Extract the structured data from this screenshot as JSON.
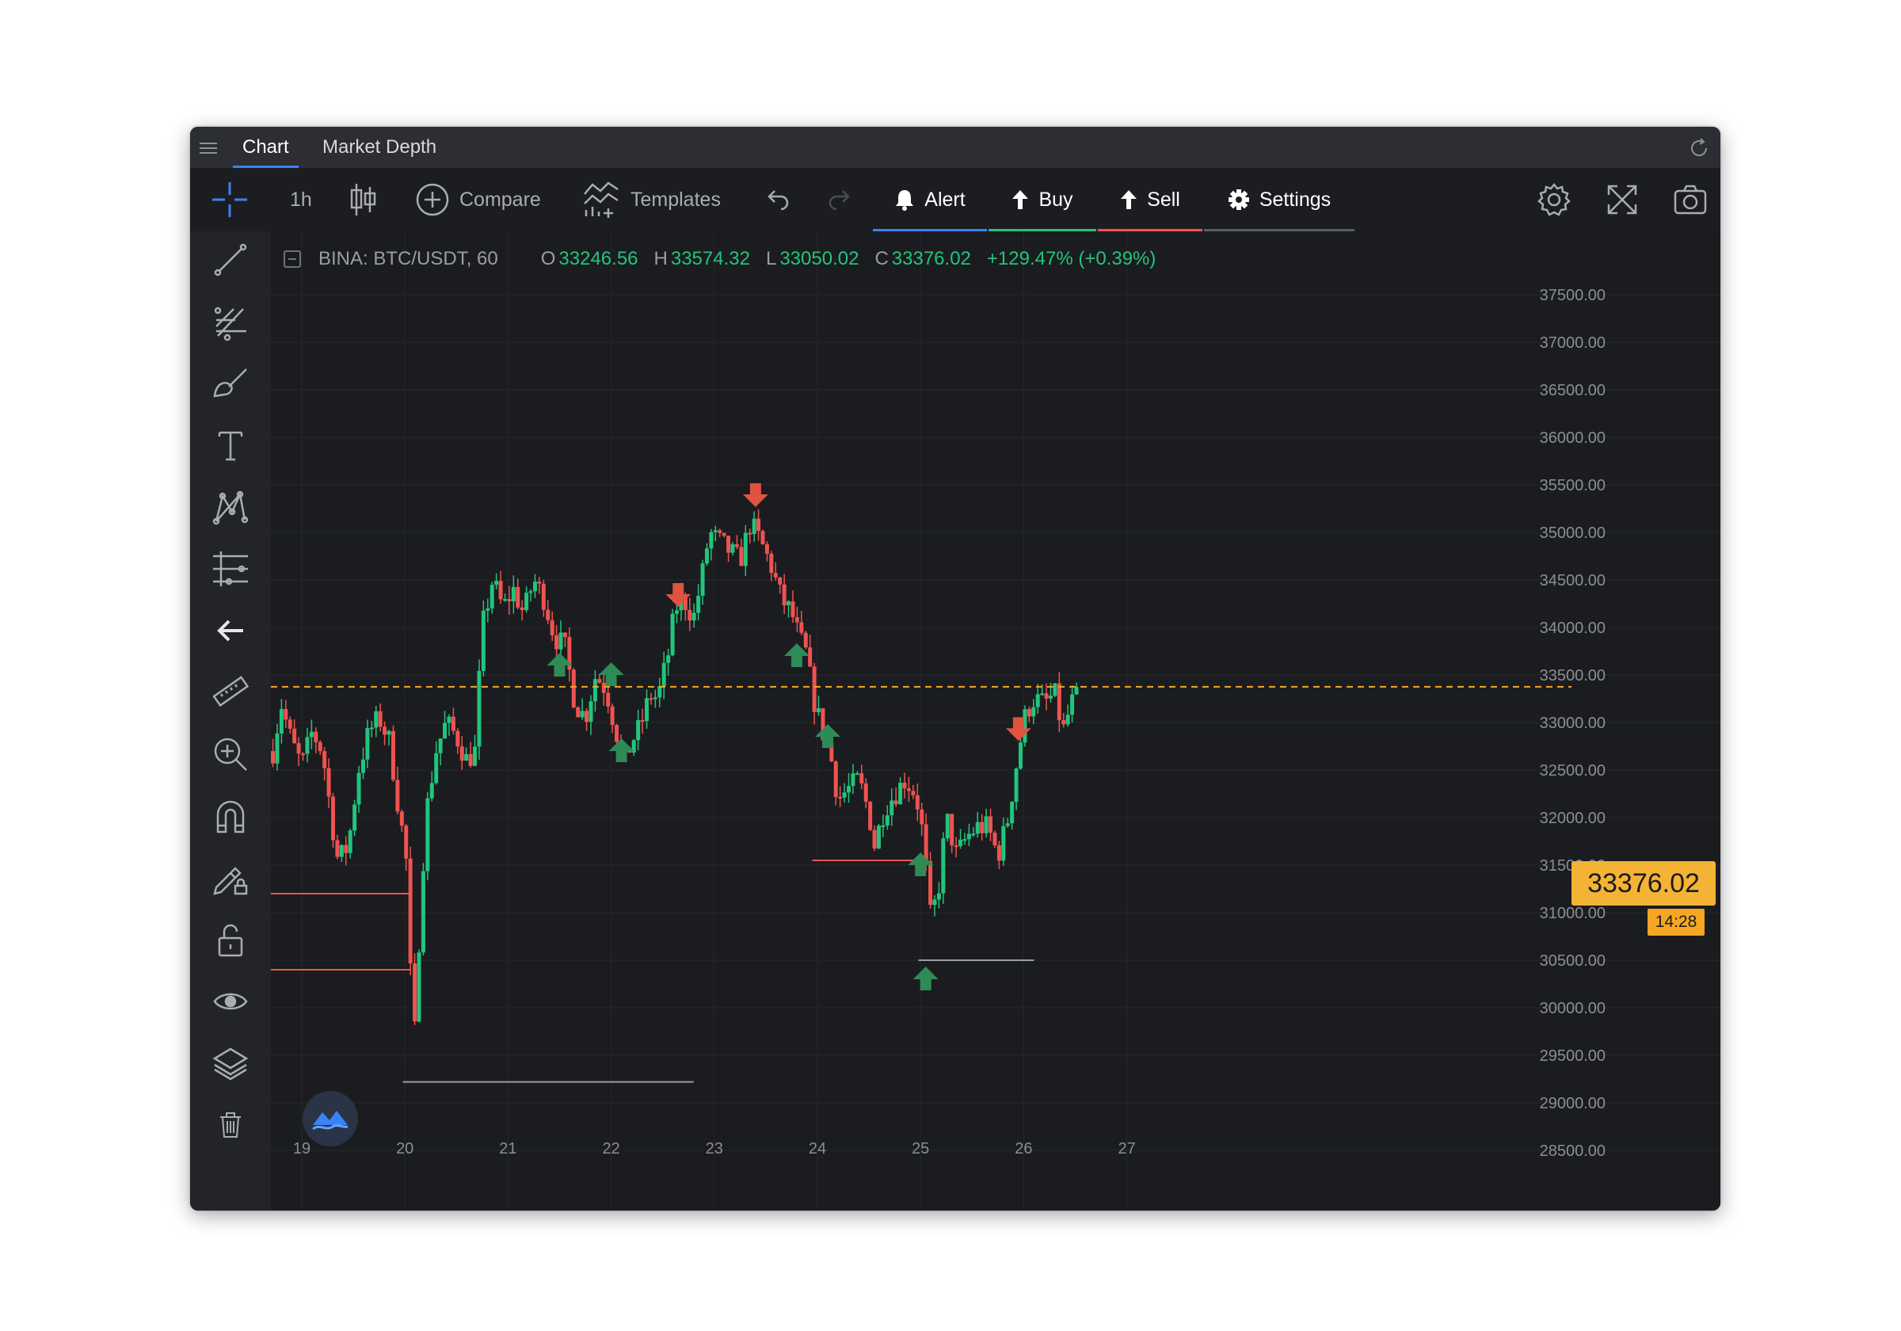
{
  "tabs": [
    {
      "label": "Chart",
      "active": true
    },
    {
      "label": "Market Depth",
      "active": false
    }
  ],
  "toolbar": {
    "interval": "1h",
    "compare": "Compare",
    "templates": "Templates",
    "alert": "Alert",
    "buy": "Buy",
    "sell": "Sell",
    "settings": "Settings",
    "icons": [
      "crosshair-icon",
      "candles-icon",
      "compare-plus-icon",
      "templates-icon",
      "undo-icon",
      "redo-icon",
      "bell-icon",
      "arrow-up-icon",
      "arrow-up-icon",
      "gear-icon",
      "settings-gear-icon",
      "fullscreen-icon",
      "camera-icon"
    ]
  },
  "left_tools": [
    "line-tool-icon",
    "fib-tool-icon",
    "brush-tool-icon",
    "text-tool-icon",
    "pattern-tool-icon",
    "measure-levels-icon",
    "back-arrow-icon",
    "ruler-icon",
    "zoom-in-icon",
    "magnet-icon",
    "lock-drawing-icon",
    "unlock-icon",
    "eye-icon",
    "layers-icon",
    "trash-icon"
  ],
  "legend": {
    "symbol": "BINA: BTC/USDT, 60",
    "o_label": "O",
    "o": "33246.56",
    "h_label": "H",
    "h": "33574.32",
    "l_label": "L",
    "l": "33050.02",
    "c_label": "C",
    "c": "33376.02",
    "change": "+129.47% (+0.39%)"
  },
  "last_price": "33376.02",
  "countdown": "14:28",
  "colors": {
    "up": "#22c47e",
    "down": "#ef5350",
    "price_line": "#f5a623",
    "accent_alert": "#3b82f6",
    "accent_buy": "#22c47e",
    "accent_sell": "#ef5350"
  },
  "chart_data": {
    "type": "candlestick",
    "symbol": "BTC/USDT",
    "interval": "60",
    "x_ticks": [
      "19",
      "20",
      "21",
      "22",
      "23",
      "24",
      "25",
      "26",
      "27"
    ],
    "y_ticks": [
      "37500.00",
      "37000.00",
      "36500.00",
      "36000.00",
      "35500.00",
      "35000.00",
      "34500.00",
      "34000.00",
      "33500.00",
      "33000.00",
      "32500.00",
      "32000.00",
      "31500.00",
      "31000.00",
      "30500.00",
      "30000.00",
      "29500.00",
      "29000.00",
      "28500.00"
    ],
    "ylim": [
      28300,
      37700
    ],
    "xlim": [
      18.7,
      27.2
    ],
    "last_price": 33376.02,
    "close_path": [
      [
        18.72,
        32700
      ],
      [
        18.8,
        33200
      ],
      [
        18.9,
        32800
      ],
      [
        19.0,
        32550
      ],
      [
        19.1,
        32900
      ],
      [
        19.2,
        32700
      ],
      [
        19.3,
        31900
      ],
      [
        19.35,
        31550
      ],
      [
        19.45,
        31700
      ],
      [
        19.55,
        32500
      ],
      [
        19.65,
        32900
      ],
      [
        19.75,
        33050
      ],
      [
        19.85,
        32800
      ],
      [
        19.95,
        32000
      ],
      [
        20.0,
        31700
      ],
      [
        20.03,
        31300
      ],
      [
        20.06,
        30100
      ],
      [
        20.1,
        29700
      ],
      [
        20.14,
        30800
      ],
      [
        20.2,
        32000
      ],
      [
        20.3,
        32700
      ],
      [
        20.4,
        33000
      ],
      [
        20.5,
        32850
      ],
      [
        20.6,
        32600
      ],
      [
        20.68,
        32700
      ],
      [
        20.75,
        34000
      ],
      [
        20.85,
        34500
      ],
      [
        20.95,
        34200
      ],
      [
        21.05,
        34400
      ],
      [
        21.15,
        34150
      ],
      [
        21.25,
        34500
      ],
      [
        21.35,
        34300
      ],
      [
        21.45,
        33900
      ],
      [
        21.55,
        33800
      ],
      [
        21.65,
        33200
      ],
      [
        21.75,
        33050
      ],
      [
        21.85,
        33500
      ],
      [
        21.95,
        33350
      ],
      [
        22.05,
        32900
      ],
      [
        22.12,
        32550
      ],
      [
        22.2,
        32800
      ],
      [
        22.28,
        32950
      ],
      [
        22.38,
        33300
      ],
      [
        22.45,
        33250
      ],
      [
        22.55,
        33700
      ],
      [
        22.62,
        34200
      ],
      [
        22.7,
        34300
      ],
      [
        22.8,
        34100
      ],
      [
        22.9,
        34650
      ],
      [
        22.95,
        35000
      ],
      [
        23.05,
        34900
      ],
      [
        23.15,
        34800
      ],
      [
        23.25,
        34700
      ],
      [
        23.35,
        35100
      ],
      [
        23.45,
        34900
      ],
      [
        23.55,
        34650
      ],
      [
        23.65,
        34300
      ],
      [
        23.75,
        34150
      ],
      [
        23.82,
        33900
      ],
      [
        23.9,
        33700
      ],
      [
        23.95,
        33300
      ],
      [
        24.05,
        32900
      ],
      [
        24.12,
        32700
      ],
      [
        24.2,
        32200
      ],
      [
        24.3,
        32300
      ],
      [
        24.4,
        32400
      ],
      [
        24.5,
        32050
      ],
      [
        24.55,
        31700
      ],
      [
        24.65,
        32100
      ],
      [
        24.75,
        32250
      ],
      [
        24.85,
        32400
      ],
      [
        24.95,
        32250
      ],
      [
        25.0,
        32000
      ],
      [
        25.05,
        31500
      ],
      [
        25.1,
        30900
      ],
      [
        25.18,
        31300
      ],
      [
        25.25,
        32000
      ],
      [
        25.35,
        31600
      ],
      [
        25.45,
        31800
      ],
      [
        25.55,
        31900
      ],
      [
        25.65,
        31900
      ],
      [
        25.75,
        31600
      ],
      [
        25.85,
        32000
      ],
      [
        25.95,
        32700
      ],
      [
        26.02,
        33100
      ],
      [
        26.1,
        33250
      ],
      [
        26.2,
        33200
      ],
      [
        26.3,
        33300
      ],
      [
        26.38,
        32900
      ],
      [
        26.45,
        33150
      ],
      [
        26.52,
        33376.02
      ]
    ],
    "signals": {
      "buy": [
        [
          21.5,
          33600
        ],
        [
          22.0,
          33500
        ],
        [
          22.1,
          32700
        ],
        [
          23.8,
          33700
        ],
        [
          24.1,
          32850
        ],
        [
          25.0,
          31500
        ],
        [
          25.05,
          30300
        ]
      ],
      "sell": [
        [
          22.65,
          34350
        ],
        [
          23.4,
          35400
        ],
        [
          25.95,
          32940
        ]
      ]
    },
    "horizontal_lines": [
      {
        "from": 18.7,
        "to": 20.05,
        "price": 31200,
        "color": "#ef5350"
      },
      {
        "from": 18.7,
        "to": 20.05,
        "price": 30400,
        "color": "#ef5350"
      },
      {
        "from": 19.98,
        "to": 22.8,
        "price": 29220,
        "color": "#9a9da3"
      },
      {
        "from": 23.95,
        "to": 25.0,
        "price": 31550,
        "color": "#ef5350"
      },
      {
        "from": 24.98,
        "to": 26.1,
        "price": 30500,
        "color": "#9a9da3"
      }
    ]
  }
}
